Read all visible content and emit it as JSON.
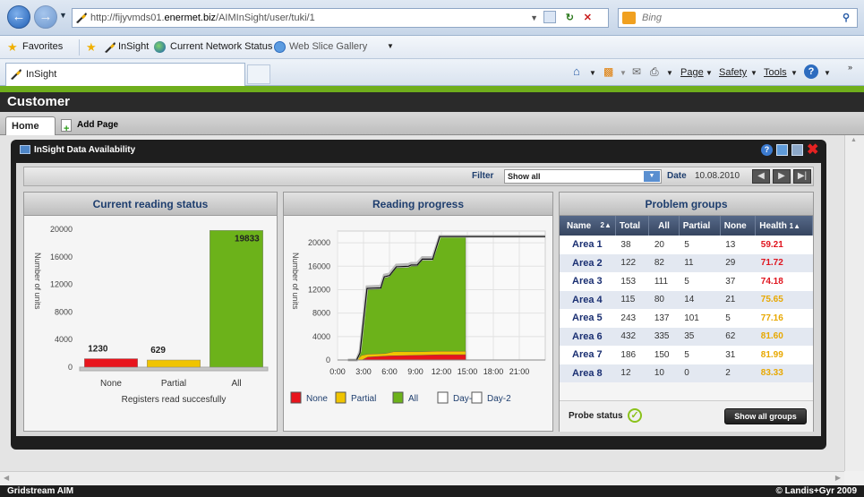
{
  "browser": {
    "url_prefix": "http://fijyvmds01.",
    "url_domain": "enermet.biz",
    "url_path": "/AIMInSight/user/tuki/1",
    "search_placeholder": "Bing",
    "favorites": [
      "Favorites",
      "InSight",
      "Current Network Status",
      "Web Slice Gallery"
    ],
    "tab_title": "InSight",
    "commands": [
      "Page",
      "Safety",
      "Tools"
    ]
  },
  "app": {
    "header": "Customer",
    "tabs": [
      "Home"
    ],
    "add_page": "Add Page",
    "footer_left": "Gridstream AIM",
    "footer_right": "© Landis+Gyr 2009"
  },
  "widget": {
    "title": "InSight Data Availability",
    "filter_label": "Filter",
    "filter_value": "Show all",
    "date_label": "Date",
    "date_value": "10.08.2010"
  },
  "current_reading": {
    "title": "Current reading status",
    "y_axis_label": "Number of units",
    "x_caption": "Registers read succesfully"
  },
  "reading_progress": {
    "title": "Reading progress",
    "y_axis_label": "Number of units",
    "legend": [
      "None",
      "Partial",
      "All",
      "Day-1",
      "Day-2"
    ]
  },
  "problem_groups": {
    "title": "Problem groups",
    "columns": [
      "Name",
      "Total",
      "All",
      "Partial",
      "None",
      "Health"
    ],
    "sort_markers": [
      "2▲",
      "1▲"
    ],
    "rows": [
      {
        "name": "Area 1",
        "total": "38",
        "all": "20",
        "partial": "5",
        "none": "13",
        "health": "59.21",
        "color": "#e0141e"
      },
      {
        "name": "Area 2",
        "total": "122",
        "all": "82",
        "partial": "11",
        "none": "29",
        "health": "71.72",
        "color": "#e0141e"
      },
      {
        "name": "Area 3",
        "total": "153",
        "all": "111",
        "partial": "5",
        "none": "37",
        "health": "74.18",
        "color": "#e0141e"
      },
      {
        "name": "Area 4",
        "total": "115",
        "all": "80",
        "partial": "14",
        "none": "21",
        "health": "75.65",
        "color": "#e8a800"
      },
      {
        "name": "Area 5",
        "total": "243",
        "all": "137",
        "partial": "101",
        "none": "5",
        "health": "77.16",
        "color": "#e8a800"
      },
      {
        "name": "Area 6",
        "total": "432",
        "all": "335",
        "partial": "35",
        "none": "62",
        "health": "81.60",
        "color": "#e8a800"
      },
      {
        "name": "Area 7",
        "total": "186",
        "all": "150",
        "partial": "5",
        "none": "31",
        "health": "81.99",
        "color": "#e8a800"
      },
      {
        "name": "Area 8",
        "total": "12",
        "all": "10",
        "partial": "0",
        "none": "2",
        "health": "83.33",
        "color": "#e8a800"
      }
    ],
    "probe_status": "Probe status",
    "show_all": "Show all groups"
  },
  "chart_data": [
    {
      "type": "bar",
      "categories": [
        "None",
        "Partial",
        "All"
      ],
      "values": [
        1230,
        629,
        19833
      ],
      "colors": [
        "#e8141c",
        "#f0c400",
        "#6cb21a"
      ],
      "xlabel": "Registers read succesfully",
      "ylabel": "Number of units",
      "ylim": [
        0,
        20000
      ],
      "yticks": [
        0,
        4000,
        8000,
        12000,
        16000,
        20000
      ]
    },
    {
      "type": "area",
      "xlabel": "",
      "ylabel": "Number of units",
      "ylim": [
        0,
        22000
      ],
      "yticks": [
        0,
        4000,
        8000,
        12000,
        16000,
        20000
      ],
      "xticks": [
        "0:00",
        "3:00",
        "6:00",
        "9:00",
        "12:00",
        "15:00",
        "18:00",
        "21:00"
      ],
      "xlim": [
        0,
        24
      ],
      "series": [
        {
          "name": "All",
          "color": "#6cb21a",
          "points": [
            [
              1.2,
              0
            ],
            [
              2.2,
              0
            ],
            [
              2.6,
              1000
            ],
            [
              3.4,
              12000
            ],
            [
              5.0,
              12100
            ],
            [
              5.4,
              14000
            ],
            [
              6.0,
              14200
            ],
            [
              6.8,
              15700
            ],
            [
              8.2,
              15800
            ],
            [
              8.5,
              16000
            ],
            [
              9.2,
              16000
            ],
            [
              9.8,
              17000
            ],
            [
              11.0,
              17000
            ],
            [
              11.8,
              21000
            ],
            [
              14.8,
              21000
            ],
            [
              14.8,
              0
            ]
          ]
        },
        {
          "name": "Partial",
          "color": "#f0c400",
          "points": [
            [
              1.2,
              0
            ],
            [
              2.2,
              0
            ],
            [
              2.8,
              800
            ],
            [
              3.5,
              1000
            ],
            [
              5.5,
              1100
            ],
            [
              6.5,
              1400
            ],
            [
              9.5,
              1400
            ],
            [
              11.5,
              1500
            ],
            [
              14.8,
              1500
            ],
            [
              14.8,
              0
            ]
          ]
        },
        {
          "name": "None",
          "color": "#e8141c",
          "points": [
            [
              1.2,
              0
            ],
            [
              2.8,
              0
            ],
            [
              3.5,
              500
            ],
            [
              6.0,
              700
            ],
            [
              9.0,
              800
            ],
            [
              12.0,
              900
            ],
            [
              14.8,
              900
            ],
            [
              14.8,
              0
            ]
          ]
        },
        {
          "name": "Day-1",
          "color": "#ffffff",
          "points": [
            [
              1.2,
              0
            ],
            [
              2.2,
              0
            ],
            [
              2.6,
              1500
            ],
            [
              3.4,
              12500
            ],
            [
              5.0,
              12600
            ],
            [
              5.4,
              14500
            ],
            [
              6.0,
              14700
            ],
            [
              6.8,
              16200
            ],
            [
              8.2,
              16300
            ],
            [
              8.5,
              16500
            ],
            [
              9.2,
              16500
            ],
            [
              9.8,
              17500
            ],
            [
              11.0,
              17500
            ],
            [
              11.8,
              21100
            ],
            [
              24,
              21100
            ]
          ]
        },
        {
          "name": "Day-2",
          "color": "#000000",
          "points": [
            [
              1.2,
              0
            ],
            [
              2.2,
              0
            ],
            [
              2.6,
              1200
            ],
            [
              3.4,
              12200
            ],
            [
              5.0,
              12300
            ],
            [
              5.4,
              14200
            ],
            [
              6.0,
              14400
            ],
            [
              6.8,
              15900
            ],
            [
              8.2,
              16000
            ],
            [
              8.5,
              16200
            ],
            [
              9.2,
              16200
            ],
            [
              9.8,
              17200
            ],
            [
              11.0,
              17200
            ],
            [
              11.8,
              21050
            ],
            [
              24,
              21050
            ]
          ]
        }
      ]
    }
  ]
}
